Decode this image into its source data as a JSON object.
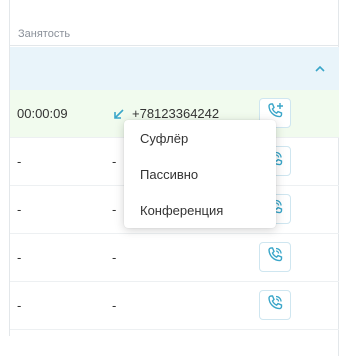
{
  "table": {
    "column_header": "Занятость",
    "rows": [
      {
        "duration": "00:00:09",
        "direction": "",
        "phone": "+78123364242",
        "action_icon": "phone-plus-icon"
      },
      {
        "duration": "-",
        "direction": "-",
        "phone": "",
        "action_icon": "phone-listen-icon"
      },
      {
        "duration": "-",
        "direction": "-",
        "phone": "",
        "action_icon": "phone-listen-icon"
      },
      {
        "duration": "-",
        "direction": "-",
        "phone": "",
        "action_icon": "phone-listen-icon"
      },
      {
        "duration": "-",
        "direction": "-",
        "phone": "",
        "action_icon": "phone-listen-icon"
      }
    ]
  },
  "group": {
    "chevron_icon": "chevron-up-icon"
  },
  "context_menu": {
    "items": [
      {
        "label": "Суфлёр"
      },
      {
        "label": "Пассивно"
      },
      {
        "label": "Конференция"
      }
    ]
  },
  "colors": {
    "accent": "#3aa6c9",
    "active_row": "#f1fbee",
    "group_bar": "#e9f4fa",
    "incoming_arrow": "#3aa6c9"
  },
  "incoming_icon": "arrow-down-left-icon"
}
